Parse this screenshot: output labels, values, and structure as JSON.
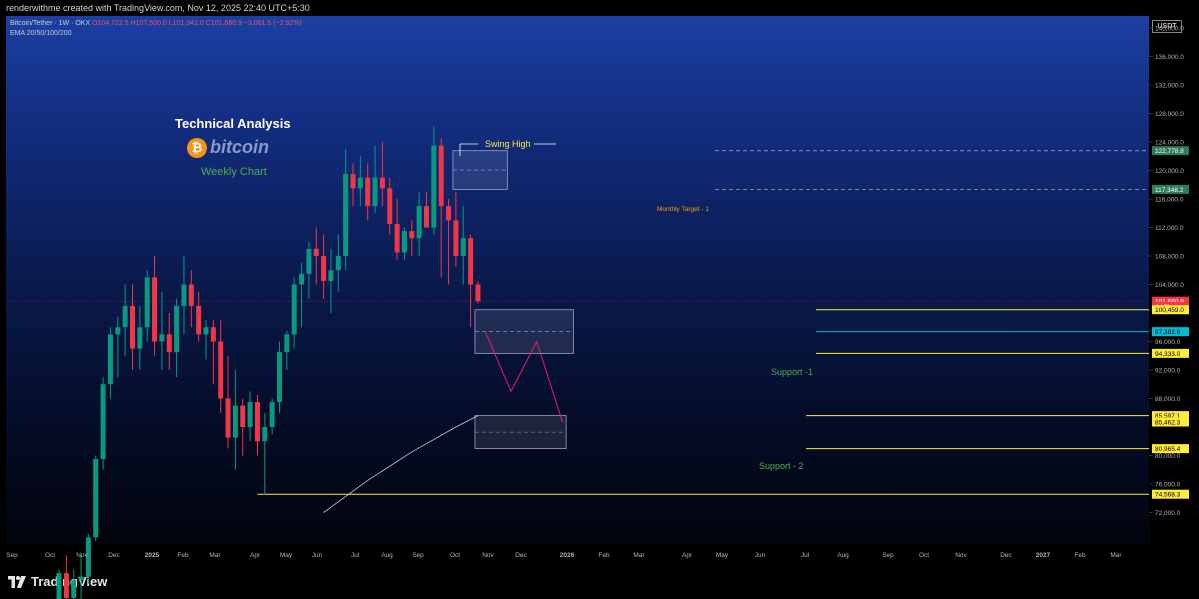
{
  "header": {
    "attribution": "renderwithme created with TradingView.com, Nov 12, 2025 22:40 UTC+5:30",
    "symbol": "Bitcoin/Tether · 1W · OKX",
    "ohlc": "O104,722.5 H107,500.0 L101,341.0 C101,660.9 −3,061.5 (−2.92%)",
    "indicator": "EMA 20/50/100/200",
    "currency": "USDT"
  },
  "annotations": {
    "title": "Technical Analysis",
    "brand": "bitcoin",
    "brand_symbol": "₿",
    "timeframe": "Weekly Chart",
    "swing_high": "Swing High",
    "monthly_target": "Monthly Target - 1",
    "support1": "Support -1",
    "support2": "Support - 2"
  },
  "footer": {
    "brand": "TradingView"
  },
  "colors": {
    "up": "#089981",
    "down": "#f23645",
    "support": "#ffeb3b",
    "zone": "#9aa4b8",
    "projection": "#e91e63"
  },
  "chart_data": {
    "type": "candlestick",
    "y_ticks": [
      72000,
      76000,
      80000,
      88000,
      92000,
      96000,
      104000,
      108000,
      112000,
      116000,
      120000,
      124000,
      128000,
      132000,
      136000,
      140000
    ],
    "y_tick_labels": [
      "72,000.0",
      "76,000.0",
      "80,000.0",
      "88,000.0",
      "92,000.0",
      "96,000.0",
      "104,000.0",
      "108,000.0",
      "112,000.0",
      "116,000.0",
      "120,000.0",
      "124,000.0",
      "128,000.0",
      "132,000.0",
      "136,000.0",
      "140,000.0"
    ],
    "x_labels": [
      "Sep",
      "Oct",
      "Nov",
      "Dec",
      "2025",
      "Feb",
      "Mar",
      "Apr",
      "May",
      "Jun",
      "Jul",
      "Aug",
      "Sep",
      "Oct",
      "Nov",
      "Dec",
      "2026",
      "Feb",
      "Mar",
      "Apr",
      "May",
      "Jun",
      "Jul",
      "Aug",
      "Sep",
      "Oct",
      "Nov",
      "Dec",
      "2027",
      "Feb",
      "Mar"
    ],
    "price_labels": [
      {
        "text": "122,778.8",
        "value": 122778.8,
        "bg": "#2e7d5b",
        "fg": "#ffffff"
      },
      {
        "text": "117,348.2",
        "value": 117348.2,
        "bg": "#2e7d5b",
        "fg": "#ffffff"
      },
      {
        "text": "101,660.9",
        "value": 101660.9,
        "bg": "#f23645",
        "fg": "#ffffff"
      },
      {
        "text": "4d 7h",
        "value": 100900,
        "bg": "#f23645",
        "fg": "#ffffff"
      },
      {
        "text": "100,459.0",
        "value": 100459,
        "bg": "#ffeb3b",
        "fg": "#000000"
      },
      {
        "text": "97,382.6",
        "value": 97382.6,
        "bg": "#00bcd4",
        "fg": "#000000"
      },
      {
        "text": "94,333.0",
        "value": 94333,
        "bg": "#ffeb3b",
        "fg": "#000000"
      },
      {
        "text": "85,597.1",
        "value": 85597.1,
        "bg": "#ffeb3b",
        "fg": "#000000"
      },
      {
        "text": "85,462.3",
        "value": 84700,
        "bg": "#ffeb3b",
        "fg": "#000000"
      },
      {
        "text": "80,965.4",
        "value": 80965.4,
        "bg": "#ffeb3b",
        "fg": "#000000"
      },
      {
        "text": "74,568.3",
        "value": 74568.3,
        "bg": "#ffeb3b",
        "fg": "#000000"
      }
    ],
    "candles": [
      [
        59000,
        64000,
        58000,
        63500
      ],
      [
        63500,
        66000,
        59000,
        60000
      ],
      [
        60000,
        64000,
        58500,
        62500
      ],
      [
        62500,
        66000,
        59000,
        63000
      ],
      [
        63000,
        69000,
        62000,
        68500
      ],
      [
        68500,
        80000,
        68000,
        79500
      ],
      [
        79500,
        91000,
        78000,
        90000
      ],
      [
        90000,
        98000,
        88000,
        97000
      ],
      [
        97000,
        99500,
        91000,
        98000
      ],
      [
        98000,
        104000,
        94000,
        101000
      ],
      [
        101000,
        104000,
        92000,
        95000
      ],
      [
        95000,
        101000,
        92000,
        98000
      ],
      [
        98000,
        106000,
        96000,
        105000
      ],
      [
        105000,
        108000,
        94000,
        96000
      ],
      [
        96000,
        103000,
        92000,
        97000
      ],
      [
        97000,
        100000,
        92000,
        94500
      ],
      [
        94500,
        102000,
        91000,
        101000
      ],
      [
        101000,
        108000,
        97000,
        104000
      ],
      [
        104000,
        106000,
        98000,
        101000
      ],
      [
        101000,
        103000,
        96000,
        97000
      ],
      [
        97000,
        99000,
        93500,
        98000
      ],
      [
        98000,
        99000,
        90000,
        96000
      ],
      [
        96000,
        99000,
        86000,
        88000
      ],
      [
        88000,
        94000,
        81000,
        82500
      ],
      [
        82500,
        92000,
        78000,
        87000
      ],
      [
        87000,
        88000,
        80000,
        84000
      ],
      [
        84000,
        89000,
        82000,
        87500
      ],
      [
        87500,
        88500,
        80000,
        82000
      ],
      [
        82000,
        86000,
        74500,
        84000
      ],
      [
        84000,
        88000,
        83000,
        87500
      ],
      [
        87500,
        96000,
        86000,
        94500
      ],
      [
        94500,
        97500,
        92000,
        97000
      ],
      [
        97000,
        105000,
        95000,
        104000
      ],
      [
        104000,
        107000,
        98000,
        105500
      ],
      [
        105500,
        110000,
        102000,
        109000
      ],
      [
        109000,
        112000,
        104000,
        108000
      ],
      [
        108000,
        111000,
        102000,
        104500
      ],
      [
        104500,
        109000,
        100000,
        106000
      ],
      [
        106000,
        111000,
        103000,
        108000
      ],
      [
        108000,
        123000,
        106000,
        119500
      ],
      [
        119500,
        121000,
        115000,
        117500
      ],
      [
        117500,
        122000,
        115000,
        119000
      ],
      [
        119000,
        121000,
        113000,
        115000
      ],
      [
        115000,
        123500,
        114000,
        119000
      ],
      [
        119000,
        124000,
        115000,
        117500
      ],
      [
        117500,
        119000,
        111000,
        112500
      ],
      [
        112500,
        116000,
        107500,
        108500
      ],
      [
        108500,
        112000,
        107500,
        111500
      ],
      [
        111500,
        113000,
        108000,
        110500
      ],
      [
        110500,
        117000,
        108000,
        115000
      ],
      [
        115000,
        117000,
        112000,
        112000
      ],
      [
        112000,
        126200,
        111000,
        123500
      ],
      [
        123500,
        124500,
        105000,
        115000
      ],
      [
        115000,
        116000,
        104000,
        113000
      ],
      [
        113000,
        117000,
        106500,
        108000
      ],
      [
        108000,
        115000,
        104000,
        110500
      ],
      [
        110500,
        111000,
        98000,
        104000
      ],
      [
        104000,
        104500,
        101341,
        101660.9
      ]
    ],
    "zones": [
      {
        "name": "monthly-target-zone",
        "x": [
          54,
          61
        ],
        "y": [
          117348.2,
          122778.8
        ]
      },
      {
        "name": "support-1-zone",
        "x": [
          57,
          70
        ],
        "y": [
          94333,
          100459
        ]
      },
      {
        "name": "support-2-zone",
        "x": [
          57,
          69
        ],
        "y": [
          80965.4,
          85597.1
        ]
      }
    ],
    "projection": [
      [
        58,
        97382.6
      ],
      [
        61.5,
        89000
      ],
      [
        65,
        96000
      ],
      [
        68.5,
        84700
      ]
    ],
    "ema_line": [
      [
        36,
        72000
      ],
      [
        42,
        76500
      ],
      [
        48,
        80500
      ],
      [
        54,
        84000
      ],
      [
        57,
        85597.1
      ]
    ]
  }
}
